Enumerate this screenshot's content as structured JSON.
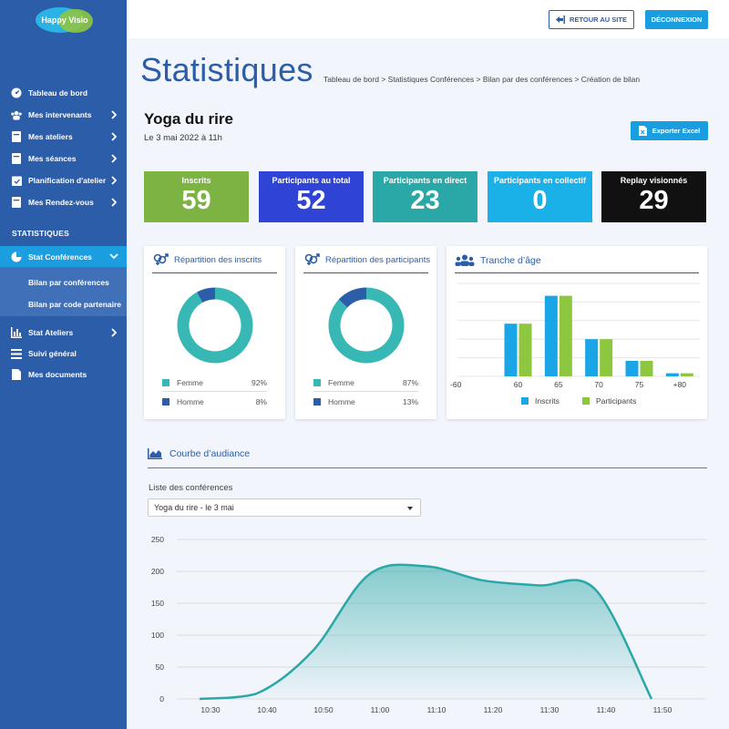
{
  "brand": {
    "logo_text": "Happy Visio"
  },
  "sidebar": {
    "items": [
      {
        "label": "Tableau de bord"
      },
      {
        "label": "Mes intervenants"
      },
      {
        "label": "Mes ateliers"
      },
      {
        "label": "Mes séances"
      },
      {
        "label": "Planification d'atelier"
      },
      {
        "label": "Mes Rendez-vous"
      }
    ],
    "section_label": "STATISTIQUES",
    "active_item": {
      "label": "Stat Conférences"
    },
    "sub_items": [
      {
        "label": "Bilan par conférences"
      },
      {
        "label": "Bilan par code partenaire"
      }
    ],
    "bottom_items": [
      {
        "label": "Stat Ateliers"
      },
      {
        "label": "Suivi général"
      },
      {
        "label": "Mes documents"
      }
    ]
  },
  "topbar": {
    "back_label": "RETOUR AU SITE",
    "logout_label": "DÉCONNEXION"
  },
  "page": {
    "title": "Statistiques",
    "breadcrumb": "Tableau de bord > Statistiques Conférences > Bilan par des conférences > Création de bilan",
    "conference_title": "Yoga du rire",
    "conference_date": "Le 3 mai 2022 à 11h",
    "export_label": "Exporter Excel"
  },
  "stats": [
    {
      "label": "Inscrits",
      "value": "59",
      "color": "#7cb342"
    },
    {
      "label": "Participants au total",
      "value": "52",
      "color": "#2f44d4"
    },
    {
      "label": "Participants en direct",
      "value": "23",
      "color": "#2aa8a8"
    },
    {
      "label": "Participants en collectif",
      "value": "0",
      "color": "#1ab0e8"
    },
    {
      "label": "Replay visionnés",
      "value": "29",
      "color": "#111111"
    }
  ],
  "donut_inscrits": {
    "title": "Répartition des inscrits",
    "legend": [
      {
        "label": "Femme",
        "pct": "92%",
        "color": "#37b8b5"
      },
      {
        "label": "Homme",
        "pct": "8%",
        "color": "#2c5da8"
      }
    ]
  },
  "donut_participants": {
    "title": "Répartition des participants",
    "legend": [
      {
        "label": "Femme",
        "pct": "87%",
        "color": "#37b8b5"
      },
      {
        "label": "Homme",
        "pct": "13%",
        "color": "#2c5da8"
      }
    ]
  },
  "age_chart": {
    "title": "Tranche d’âge",
    "legend": [
      "Inscrits",
      "Participants"
    ]
  },
  "audience": {
    "title": "Courbe d’audiance",
    "list_label": "Liste des conférences",
    "selected": "Yoga du rire - le 3 mai"
  },
  "chart_data": [
    {
      "type": "pie",
      "title": "Répartition des inscrits",
      "categories": [
        "Femme",
        "Homme"
      ],
      "values": [
        92,
        8
      ]
    },
    {
      "type": "pie",
      "title": "Répartition des participants",
      "categories": [
        "Femme",
        "Homme"
      ],
      "values": [
        87,
        13
      ]
    },
    {
      "type": "bar",
      "title": "Tranche d’âge",
      "categories": [
        "-60",
        "60",
        "65",
        "70",
        "75",
        "+80"
      ],
      "series": [
        {
          "name": "Inscrits",
          "values": [
            0,
            17,
            26,
            12,
            5,
            1
          ],
          "color": "#1aa6e6"
        },
        {
          "name": "Participants",
          "values": [
            0,
            17,
            26,
            12,
            5,
            1
          ],
          "color": "#8dc63f"
        }
      ]
    },
    {
      "type": "area",
      "title": "Courbe d’audiance",
      "x": [
        "10:30",
        "10:40",
        "10:50",
        "11:00",
        "11:10",
        "11:20",
        "11:30",
        "11:40",
        "11:50"
      ],
      "xticks": [
        "10:30",
        "10:40",
        "10:50",
        "11:00",
        "11:10",
        "11:20",
        "11:30",
        "11:40",
        "11:50"
      ],
      "values": [
        0,
        8,
        75,
        195,
        208,
        186,
        178,
        172,
        0
      ],
      "ylim": [
        0,
        250
      ],
      "yticks": [
        0,
        50,
        100,
        150,
        200,
        250
      ],
      "color": "#2aa8a8",
      "grid": true
    }
  ]
}
